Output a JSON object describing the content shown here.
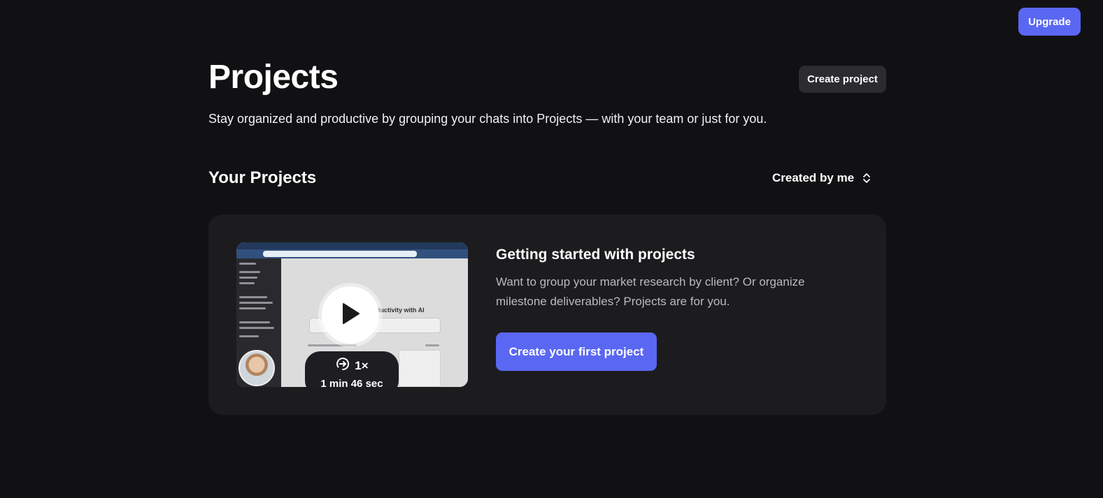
{
  "header": {
    "upgrade_label": "Upgrade"
  },
  "main": {
    "title": "Projects",
    "create_project_label": "Create project",
    "subtitle": "Stay organized and productive by grouping your chats into Projects — with your team or just for you.",
    "section_title": "Your Projects",
    "sort": {
      "selected": "Created by me",
      "icon": "chevron-up-down-icon"
    }
  },
  "onboarding_card": {
    "video": {
      "screen_headline": "ductivity with AI",
      "playback_speed": "1×",
      "duration": "1 min 46 sec",
      "icons": [
        "play-icon",
        "playback-speed-icon"
      ]
    },
    "title": "Getting started with projects",
    "description": "Want to group your market research by client? Or organize milestone deliverables? Projects are for you.",
    "cta_label": "Create your first project"
  },
  "colors": {
    "background": "#111114",
    "card": "#1c1c1f",
    "accent": "#5a67f2",
    "secondary_button": "#2c2c30",
    "muted_text": "#b9b9c0"
  }
}
